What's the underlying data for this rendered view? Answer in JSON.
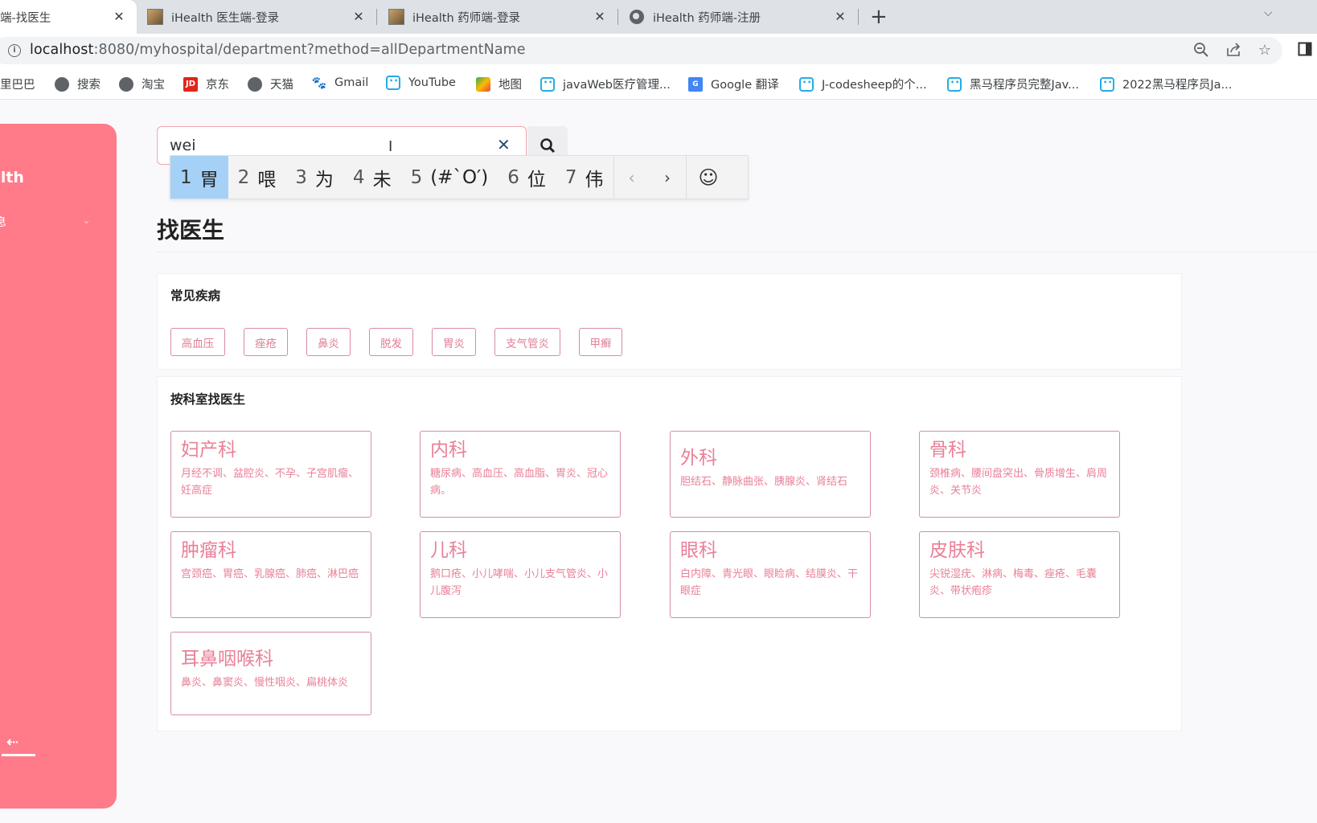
{
  "browser": {
    "tabs": [
      {
        "title": "端-找医生",
        "active": true,
        "icon": "page-icon"
      },
      {
        "title": "iHealth 医生端-登录",
        "active": false,
        "icon": "tomcat-icon"
      },
      {
        "title": "iHealth 药师端-登录",
        "active": false,
        "icon": "tomcat-icon"
      },
      {
        "title": "iHealth 药师端-注册",
        "active": false,
        "icon": "globe-icon"
      }
    ],
    "close_glyph": "✕",
    "new_tab_glyph": "+",
    "dropdown_glyph": "⌵",
    "url_host": "localhost",
    "url_rest": ":8080/myhospital/department?method=allDepartmentName",
    "bookmarks": [
      {
        "label": "里巴巴",
        "icon": "none"
      },
      {
        "label": "搜索",
        "icon": "globe-icon"
      },
      {
        "label": "淘宝",
        "icon": "globe-icon"
      },
      {
        "label": "京东",
        "icon": "jd-icon"
      },
      {
        "label": "天猫",
        "icon": "globe-icon"
      },
      {
        "label": "Gmail",
        "icon": "baidu-paw-icon"
      },
      {
        "label": "YouTube",
        "icon": "bilibili-icon"
      },
      {
        "label": "地图",
        "icon": "maps-icon"
      },
      {
        "label": "javaWeb医疗管理...",
        "icon": "bilibili-icon"
      },
      {
        "label": "Google 翻译",
        "icon": "google-translate-icon"
      },
      {
        "label": "J-codesheep的个...",
        "icon": "bilibili-icon"
      },
      {
        "label": "黑马程序员完整Jav...",
        "icon": "bilibili-icon"
      },
      {
        "label": "2022黑马程序员Ja...",
        "icon": "bilibili-icon"
      }
    ]
  },
  "sidebar": {
    "brand": "alth",
    "menu_item": "息",
    "chevron": "⌄",
    "logout_glyph": "⇠"
  },
  "search": {
    "value": "wei",
    "clear_glyph": "✕"
  },
  "ime": {
    "candidates": [
      {
        "n": "1",
        "text": "胃",
        "selected": true
      },
      {
        "n": "2",
        "text": "喂",
        "selected": false
      },
      {
        "n": "3",
        "text": "为",
        "selected": false
      },
      {
        "n": "4",
        "text": "未",
        "selected": false
      },
      {
        "n": "5",
        "text": "(#`O′)",
        "selected": false
      },
      {
        "n": "6",
        "text": "位",
        "selected": false
      },
      {
        "n": "7",
        "text": "伟",
        "selected": false
      }
    ],
    "prev": "‹",
    "next": "›",
    "emoji": "☺"
  },
  "page": {
    "title": "找医生",
    "common_diseases": {
      "heading": "常见疾病",
      "tags": [
        "高血压",
        "痤疮",
        "鼻炎",
        "脱发",
        "胃炎",
        "支气管炎",
        "甲癣"
      ]
    },
    "departments": {
      "heading": "按科室找医生",
      "items": [
        {
          "name": "妇产科",
          "desc": "月经不调、盆腔炎、不孕、子宫肌瘤、妊高症"
        },
        {
          "name": "内科",
          "desc": "糖尿病、高血压、高血脂、胃炎、冠心病。"
        },
        {
          "name": "外科",
          "desc": "胆结石、静脉曲张、胰腺炎、肾结石"
        },
        {
          "name": "骨科",
          "desc": "颈椎病、腰间盘突出、骨质增生、肩周炎、关节炎"
        },
        {
          "name": "肿瘤科",
          "desc": "宫颈癌、胃癌、乳腺癌、肺癌、淋巴癌"
        },
        {
          "name": "儿科",
          "desc": "鹅口疮、小儿哮喘、小儿支气管炎、小儿腹泻"
        },
        {
          "name": "眼科",
          "desc": "白内障、青光眼、眼睑病、结膜炎、干眼症"
        },
        {
          "name": "皮肤科",
          "desc": "尖锐湿疣、淋病、梅毒、痤疮、毛囊炎、带状疱疹"
        },
        {
          "name": "耳鼻咽喉科",
          "desc": "鼻炎、鼻窦炎、慢性咽炎、扁桃体炎"
        }
      ]
    }
  }
}
